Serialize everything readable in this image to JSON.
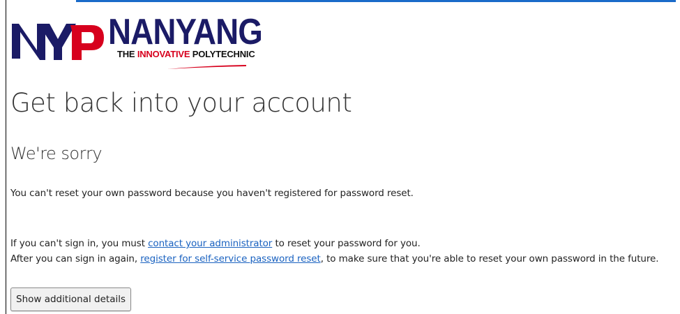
{
  "logo": {
    "monogram": "NYP",
    "name": "NANYANG",
    "tagline_pre": "THE ",
    "tagline_highlight": "INNOVATIVE",
    "tagline_post": " POLYTECHNIC"
  },
  "page": {
    "title": "Get back into your account",
    "subtitle": "We're sorry",
    "message_1": "You can't reset your own password because you haven't registered for password reset.",
    "message_2_pre": "If you can't sign in, you must ",
    "message_2_link": "contact your administrator",
    "message_2_post": " to reset your password for you.",
    "message_3_pre": "After you can sign in again, ",
    "message_3_link": "register for self-service password reset",
    "message_3_post": ", to make sure that you're able to reset your own password in the future.",
    "details_button": "Show additional details"
  },
  "colors": {
    "brand_navy": "#1b1b66",
    "brand_red": "#d7001d",
    "link": "#1a62c0"
  }
}
